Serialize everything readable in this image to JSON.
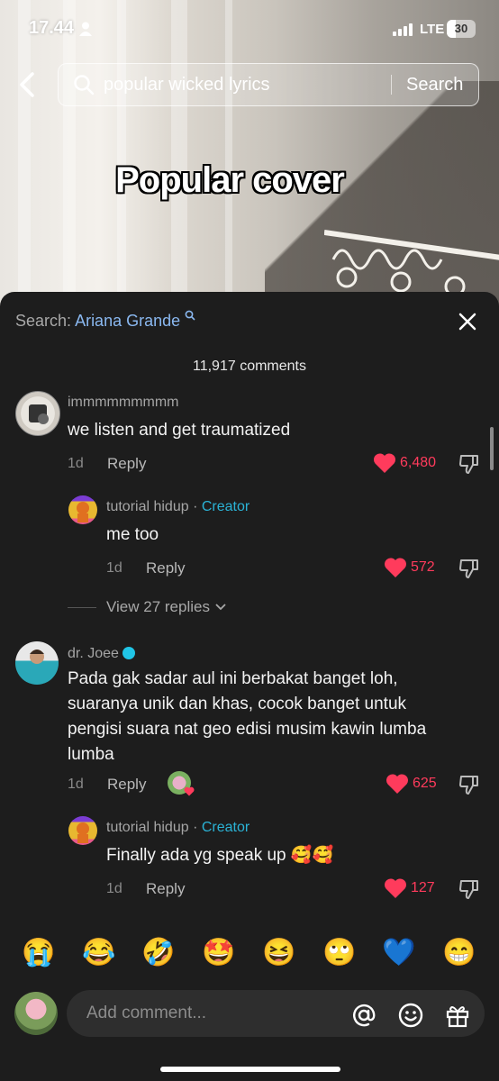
{
  "status": {
    "time": "17.44",
    "network": "LTE",
    "battery": "30",
    "battery_level": 0.3
  },
  "search": {
    "query": "popular wicked lyrics",
    "button_label": "Search"
  },
  "video": {
    "caption": "Popular cover"
  },
  "sheet": {
    "search_label": "Search:",
    "search_term": "Ariana Grande",
    "comments_count": "11,917 comments"
  },
  "comments": [
    {
      "username": "immmmmmmmm",
      "text": "we listen and get traumatized",
      "time": "1d",
      "reply_label": "Reply",
      "likes": "6,480"
    },
    {
      "username": "tutorial hidup",
      "creator_label": "Creator",
      "text": "me too",
      "time": "1d",
      "reply_label": "Reply",
      "likes": "572"
    },
    {
      "view_replies": "View 27 replies"
    },
    {
      "username": "dr. Joee",
      "text_lines": [
        "Pada gak sadar aul ini berbakat banget loh,",
        "suaranya unik dan khas, cocok banget untuk",
        "pengisi suara nat geo edisi musim kawin lumba",
        "lumba"
      ],
      "time": "1d",
      "reply_label": "Reply",
      "likes": "625"
    },
    {
      "username": "tutorial hidup",
      "creator_label": "Creator",
      "text": "Finally ada yg speak up 🥰🥰",
      "time": "1d",
      "reply_label": "Reply",
      "likes": "127"
    }
  ],
  "emojis": [
    "😭",
    "😂",
    "🤣",
    "🤩",
    "😆",
    "🙄",
    "💙",
    "😁"
  ],
  "input": {
    "placeholder": "Add comment..."
  },
  "icons": [
    "back-icon",
    "search-icon",
    "close-icon",
    "heart-icon",
    "dislike-icon",
    "at-icon",
    "emoji-icon",
    "gift-icon"
  ],
  "colors": {
    "like": "#ff3b5c",
    "creator": "#2bb3d6",
    "search_term": "#8ab8f0"
  }
}
